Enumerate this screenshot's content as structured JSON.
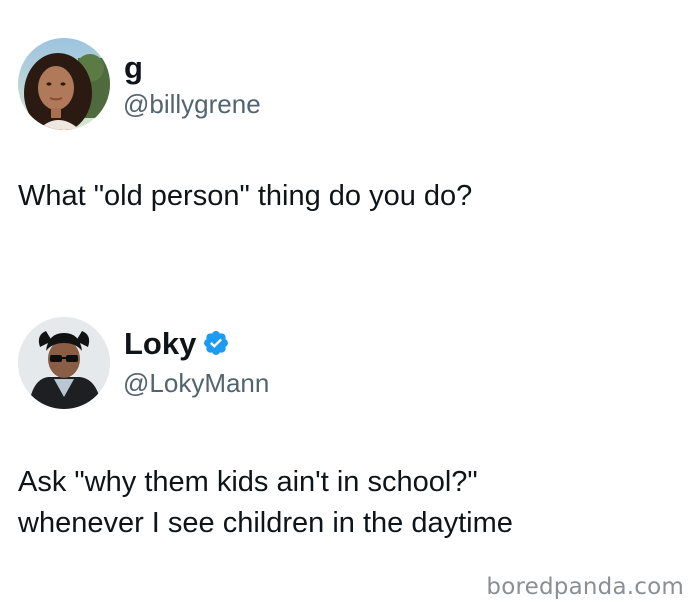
{
  "tweets": [
    {
      "display_name": "g",
      "handle": "@billygrene",
      "verified": false,
      "text_lines": [
        "What \"old person\" thing do you do?"
      ]
    },
    {
      "display_name": "Loky",
      "handle": "@LokyMann",
      "verified": true,
      "text_lines": [
        "Ask \"why them kids ain't in school?\"",
        "whenever I see children in the daytime"
      ]
    }
  ],
  "watermark": "boredpanda.com",
  "colors": {
    "text": "#0f1419",
    "handle": "#536471",
    "verified_badge": "#1d9bf0",
    "watermark": "#8a8f94"
  },
  "icons": {
    "verified": "verified-badge-icon"
  }
}
